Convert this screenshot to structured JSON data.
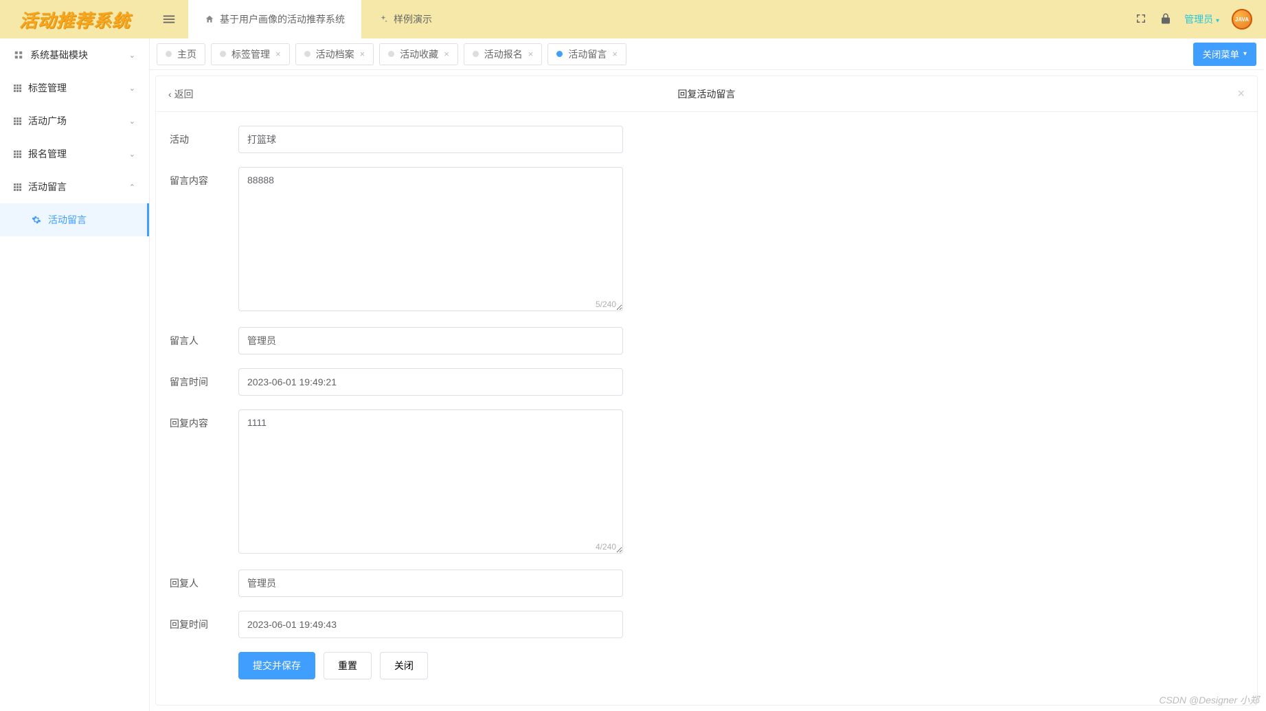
{
  "logo": "活动推荐系统",
  "topNav": [
    {
      "label": "基于用户画像的活动推荐系统",
      "icon": "home",
      "active": true
    },
    {
      "label": "样例演示",
      "icon": "sparkle",
      "active": false
    }
  ],
  "user": {
    "name": "管理员",
    "avatar_text": "JAVA"
  },
  "sidebar": {
    "items": [
      {
        "label": "系统基础模块",
        "icon": "module",
        "open": false
      },
      {
        "label": "标签管理",
        "icon": "grid",
        "open": false
      },
      {
        "label": "活动广场",
        "icon": "grid",
        "open": false
      },
      {
        "label": "报名管理",
        "icon": "grid",
        "open": false
      },
      {
        "label": "活动留言",
        "icon": "grid",
        "open": true,
        "children": [
          {
            "label": "活动留言",
            "active": true
          }
        ]
      }
    ]
  },
  "tabs": [
    {
      "label": "主页",
      "closable": false,
      "active": false
    },
    {
      "label": "标签管理",
      "closable": true,
      "active": false
    },
    {
      "label": "活动档案",
      "closable": true,
      "active": false
    },
    {
      "label": "活动收藏",
      "closable": true,
      "active": false
    },
    {
      "label": "活动报名",
      "closable": true,
      "active": false
    },
    {
      "label": "活动留言",
      "closable": true,
      "active": true
    }
  ],
  "close_menu_label": "关闭菜单",
  "page": {
    "back": "返回",
    "title": "回复活动留言"
  },
  "form": {
    "activity": {
      "label": "活动",
      "value": "打篮球"
    },
    "msg_content": {
      "label": "留言内容",
      "value": "88888",
      "counter": "5/240"
    },
    "msg_user": {
      "label": "留言人",
      "value": "管理员"
    },
    "msg_time": {
      "label": "留言时间",
      "value": "2023-06-01 19:49:21"
    },
    "reply_content": {
      "label": "回复内容",
      "value": "1111",
      "counter": "4/240"
    },
    "reply_user": {
      "label": "回复人",
      "value": "管理员"
    },
    "reply_time": {
      "label": "回复时间",
      "value": "2023-06-01 19:49:43"
    }
  },
  "buttons": {
    "submit": "提交并保存",
    "reset": "重置",
    "close": "关闭"
  },
  "watermark": "CSDN @Designer 小郑"
}
